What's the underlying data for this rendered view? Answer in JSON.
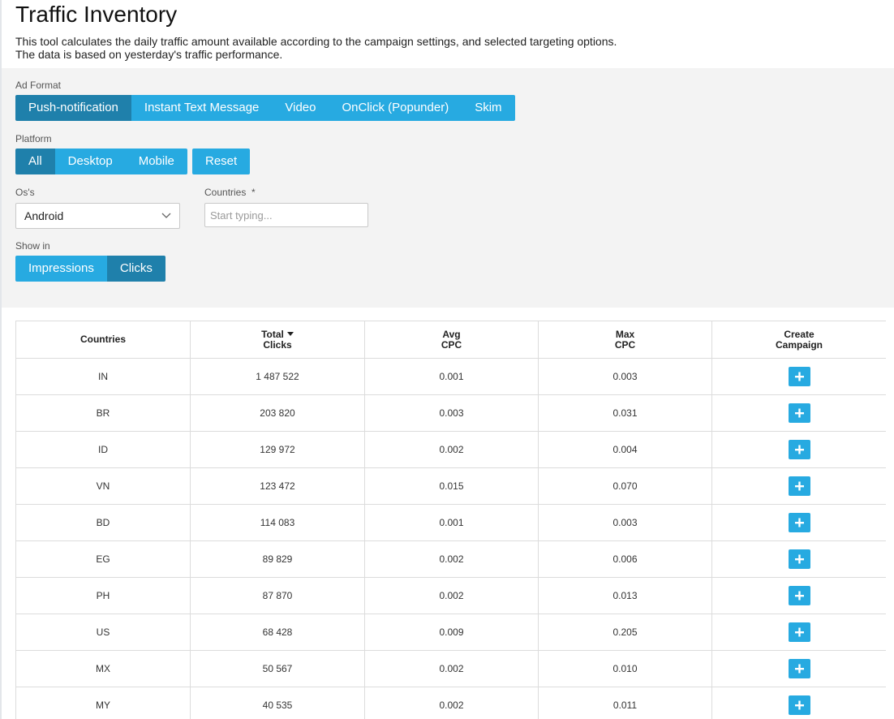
{
  "page": {
    "title": "Traffic Inventory",
    "description_line1": "This tool calculates the daily traffic amount available according to the campaign settings, and selected targeting options.",
    "description_line2": "The data is based on yesterday's traffic performance."
  },
  "filters": {
    "ad_format": {
      "label": "Ad Format",
      "options": [
        "Push-notification",
        "Instant Text Message",
        "Video",
        "OnClick (Popunder)",
        "Skim"
      ],
      "selected": "Push-notification"
    },
    "platform": {
      "label": "Platform",
      "options": [
        "All",
        "Desktop",
        "Mobile"
      ],
      "selected": "All",
      "reset_label": "Reset"
    },
    "os": {
      "label": "Os's",
      "value": "Android"
    },
    "countries": {
      "label": "Countries",
      "required_mark": "*",
      "placeholder": "Start typing..."
    },
    "show_in": {
      "label": "Show in",
      "options": [
        "Impressions",
        "Clicks"
      ],
      "selected": "Clicks"
    }
  },
  "colors": {
    "button": "#27aae1",
    "button_active": "#1f80ab",
    "panel_bg": "#f3f3f3"
  },
  "table": {
    "headers": [
      {
        "line1": "Countries",
        "line2": ""
      },
      {
        "line1": "Total",
        "line2": "Clicks",
        "sorted": "desc"
      },
      {
        "line1": "Avg",
        "line2": "CPC"
      },
      {
        "line1": "Max",
        "line2": "CPC"
      },
      {
        "line1": "Create",
        "line2": "Campaign"
      }
    ],
    "rows": [
      {
        "country": "IN",
        "total": "1 487 522",
        "avg_cpc": "0.001",
        "max_cpc": "0.003"
      },
      {
        "country": "BR",
        "total": "203 820",
        "avg_cpc": "0.003",
        "max_cpc": "0.031"
      },
      {
        "country": "ID",
        "total": "129 972",
        "avg_cpc": "0.002",
        "max_cpc": "0.004"
      },
      {
        "country": "VN",
        "total": "123 472",
        "avg_cpc": "0.015",
        "max_cpc": "0.070"
      },
      {
        "country": "BD",
        "total": "114 083",
        "avg_cpc": "0.001",
        "max_cpc": "0.003"
      },
      {
        "country": "EG",
        "total": "89 829",
        "avg_cpc": "0.002",
        "max_cpc": "0.006"
      },
      {
        "country": "PH",
        "total": "87 870",
        "avg_cpc": "0.002",
        "max_cpc": "0.013"
      },
      {
        "country": "US",
        "total": "68 428",
        "avg_cpc": "0.009",
        "max_cpc": "0.205"
      },
      {
        "country": "MX",
        "total": "50 567",
        "avg_cpc": "0.002",
        "max_cpc": "0.010"
      },
      {
        "country": "MY",
        "total": "40 535",
        "avg_cpc": "0.002",
        "max_cpc": "0.011"
      }
    ]
  }
}
